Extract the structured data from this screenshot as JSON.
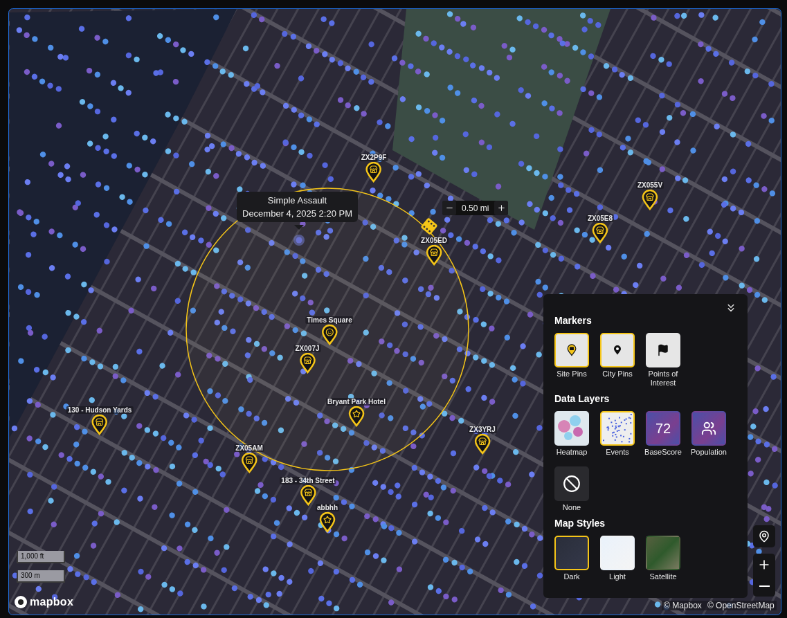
{
  "tooltip": {
    "title": "Simple Assault",
    "time": "December 4, 2025 2:20 PM"
  },
  "radius": {
    "value": "0.50 mi"
  },
  "markers": [
    {
      "label": "ZX2P9F",
      "kind": "site"
    },
    {
      "label": "ZX05ED",
      "kind": "site"
    },
    {
      "label": "ZX05E8",
      "kind": "site"
    },
    {
      "label": "ZX055V",
      "kind": "site"
    },
    {
      "label": "Times Square",
      "kind": "landmark"
    },
    {
      "label": "ZX007J",
      "kind": "site"
    },
    {
      "label": "Bryant Park Hotel",
      "kind": "poi"
    },
    {
      "label": "130 - Hudson Yards",
      "kind": "site"
    },
    {
      "label": "ZX3YRJ",
      "kind": "site"
    },
    {
      "label": "ZX05AM",
      "kind": "site"
    },
    {
      "label": "183 - 34th Street",
      "kind": "site"
    },
    {
      "label": "abbhh",
      "kind": "poi"
    }
  ],
  "scale": [
    "1,000 ft",
    "300 m"
  ],
  "logo": "mapbox",
  "attribution": [
    "© Mapbox",
    "© OpenStreetMap"
  ],
  "panel": {
    "sections": [
      {
        "title": "Markers",
        "options": [
          {
            "label": "Site Pins",
            "kind": "site",
            "selected": true
          },
          {
            "label": "City Pins",
            "kind": "city",
            "selected": true
          },
          {
            "label": "Points of Interest",
            "kind": "poi",
            "selected": false
          }
        ]
      },
      {
        "title": "Data Layers",
        "options": [
          {
            "label": "Heatmap",
            "kind": "heatmap",
            "selected": false
          },
          {
            "label": "Events",
            "kind": "events",
            "selected": true
          },
          {
            "label": "BaseScore",
            "kind": "basescore",
            "selected": false,
            "badge": "72"
          },
          {
            "label": "Population",
            "kind": "population",
            "selected": false
          },
          {
            "label": "None",
            "kind": "none",
            "selected": false
          }
        ]
      },
      {
        "title": "Map Styles",
        "options": [
          {
            "label": "Dark",
            "kind": "dark",
            "selected": true
          },
          {
            "label": "Light",
            "kind": "light",
            "selected": false
          },
          {
            "label": "Satellite",
            "kind": "satellite",
            "selected": false
          }
        ]
      }
    ]
  }
}
